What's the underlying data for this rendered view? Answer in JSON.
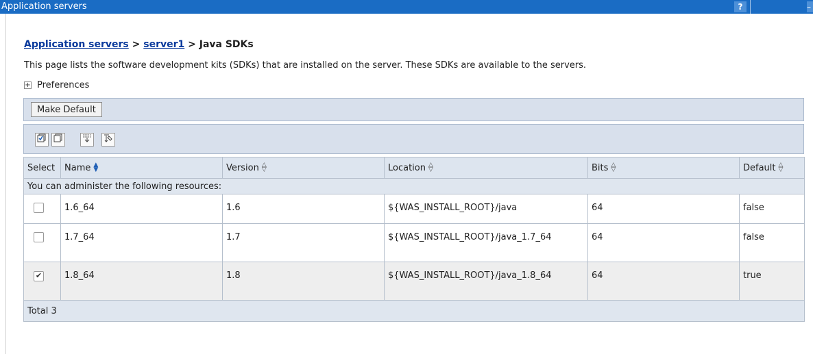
{
  "window": {
    "title": "Application servers",
    "help_label": "?"
  },
  "breadcrumb": {
    "item1": "Application servers",
    "sep1": " > ",
    "item2": "server1",
    "sep2": " > ",
    "current": "Java SDKs"
  },
  "description": "This page lists the software development kits (SDKs) that are installed on the server. These SDKs are available to the servers.",
  "preferences": {
    "label": "Preferences",
    "expand_glyph": "+"
  },
  "toolbar": {
    "make_default_label": "Make Default",
    "icons": [
      "select-all-icon",
      "deselect-all-icon",
      "show-filter-icon",
      "clear-filter-icon"
    ]
  },
  "table": {
    "columns": {
      "select": "Select",
      "name": "Name",
      "version": "Version",
      "location": "Location",
      "bits": "Bits",
      "default": "Default"
    },
    "info_text": "You can administer the following resources:",
    "rows": [
      {
        "checked": false,
        "name": "1.6_64",
        "version": "1.6",
        "location": "${WAS_INSTALL_ROOT}/java",
        "bits": "64",
        "default": "false"
      },
      {
        "checked": false,
        "name": "1.7_64",
        "version": "1.7",
        "location": "${WAS_INSTALL_ROOT}/java_1.7_64",
        "bits": "64",
        "default": "false"
      },
      {
        "checked": true,
        "name": "1.8_64",
        "version": "1.8",
        "location": "${WAS_INSTALL_ROOT}/java_1.8_64",
        "bits": "64",
        "default": "true"
      }
    ],
    "total_text": "Total 3"
  },
  "colors": {
    "titlebar": "#1a6cc4",
    "link": "#0a3a9c",
    "panel": "#d8e0ec",
    "header": "#dde5ef"
  }
}
